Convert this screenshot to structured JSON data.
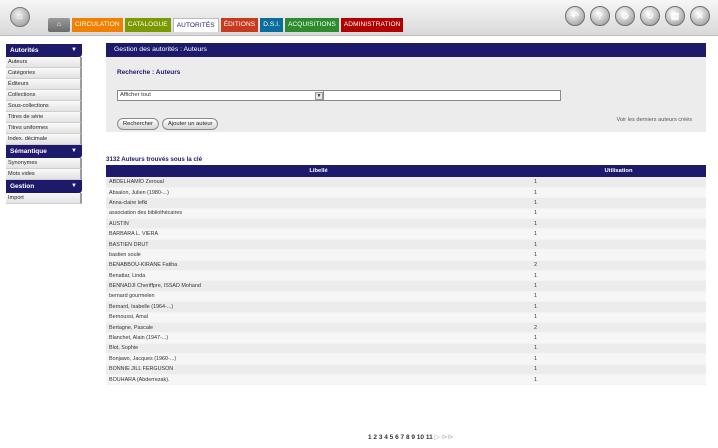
{
  "header": {
    "home_icon": "home-icon",
    "small_button_label": "⌂",
    "tabs": [
      {
        "label": "Circulation",
        "color": "#f08000"
      },
      {
        "label": "Catalogue",
        "color": "#7a9a00"
      },
      {
        "label": "Autorités",
        "color": "#ffffff",
        "active": true
      },
      {
        "label": "Éditions",
        "color": "#c83a1e"
      },
      {
        "label": "D.S.I.",
        "color": "#0a6e9c"
      },
      {
        "label": "Acquisitions",
        "color": "#2e8b2e"
      },
      {
        "label": "Administration",
        "color": "#b00000"
      }
    ],
    "tools": [
      "back-icon",
      "help-icon",
      "settings-icon",
      "refresh-icon",
      "print-icon",
      "close-icon"
    ]
  },
  "sidebar": {
    "sections": [
      {
        "title": "Autorités",
        "items": [
          "Auteurs",
          "Catégories",
          "Éditeurs",
          "Collections",
          "Sous-collections",
          "Titres de série",
          "Titres uniformes",
          "Index. décimale"
        ]
      },
      {
        "title": "Sémantique",
        "items": [
          "Synonymes",
          "Mots vides"
        ]
      },
      {
        "title": "Gestion",
        "items": [
          "Import"
        ]
      }
    ]
  },
  "main": {
    "page_title": "Gestion des autorités : Auteurs",
    "search_title": "Recherche : Auteurs",
    "select_value": "Afficher tout",
    "search_input_value": "",
    "search_button": "Rechercher",
    "add_button": "Ajouter un auteur",
    "recent_link": "Voir les derniers auteurs créés",
    "result_title": "3132 Auteurs trouvés sous la clé",
    "columns": [
      "Libellé",
      "Utilisation"
    ],
    "rows": [
      [
        "ABDELHAMID Zeroual",
        "1"
      ],
      [
        "Absalon, Julien (1980-...)",
        "1"
      ],
      [
        "Anna-claire lefki",
        "1"
      ],
      [
        "association des bibliothécaires",
        "1"
      ],
      [
        "AUSTIN",
        "1"
      ],
      [
        "BARBARA L. VIERA",
        "1"
      ],
      [
        "BASTIEN DRUT",
        "1"
      ],
      [
        "bastien soule",
        "1"
      ],
      [
        "BENABBOU-KIRANE Fatiha",
        "2"
      ],
      [
        "Benattar, Linda",
        "1"
      ],
      [
        "BENNADJI Cheriffpre, ISSAD Mohand",
        "1"
      ],
      [
        "bernard gourmelen",
        "1"
      ],
      [
        "Bernard, Isabelle (1964-...)",
        "1"
      ],
      [
        "Bernoussi, Amal",
        "1"
      ],
      [
        "Bertagne, Pascale",
        "2"
      ],
      [
        "Blanchet, Alain (1947-...)",
        "1"
      ],
      [
        "Blot, Sophie",
        "1"
      ],
      [
        "Bonjawo, Jacques (1960-...)",
        "1"
      ],
      [
        "BONNIE JILL FERGUSON",
        "1"
      ],
      [
        "BOUHARA (Abderrezak).",
        "1"
      ]
    ],
    "pager": {
      "pages": "1 2 3 4 5 6 7 8 9 10 11",
      "next": "▷",
      "last": "⊳⊳"
    }
  }
}
